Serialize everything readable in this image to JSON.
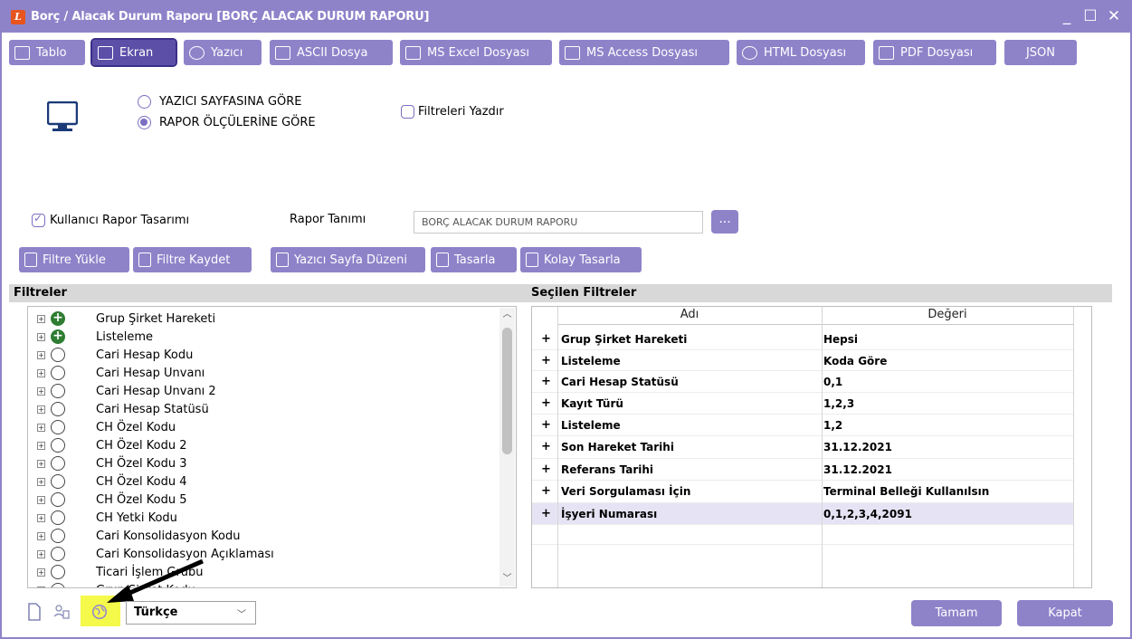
{
  "window": {
    "title": "Borç / Alacak Durum Raporu [BORÇ ALACAK DURUM RAPORU]",
    "controls": [
      "_",
      "☐",
      "✕"
    ]
  },
  "tabs": [
    {
      "label": "Tablo",
      "icon": "table-icon"
    },
    {
      "label": "Ekran",
      "icon": "monitor-icon",
      "active": true
    },
    {
      "label": "Yazıcı",
      "icon": "printer-icon"
    },
    {
      "label": "ASCII Dosya",
      "icon": "ascii-file-icon"
    },
    {
      "label": "MS Excel Dosyası",
      "icon": "excel-file-icon"
    },
    {
      "label": "MS Access Dosyası",
      "icon": "access-file-icon"
    },
    {
      "label": "HTML Dosyası",
      "icon": "globe-icon"
    },
    {
      "label": "PDF Dosyası",
      "icon": "pdf-file-icon"
    },
    {
      "label": "JSON",
      "icon": ""
    }
  ],
  "output": {
    "radio_page": "YAZICI SAYFASINA GÖRE",
    "radio_report": "RAPOR ÖLÇÜLERİNE GÖRE",
    "radio_selected": "RAPOR ÖLÇÜLERİNE GÖRE",
    "print_filters": "Filtreleri Yazdır"
  },
  "design": {
    "user_design_label": "Kullanıcı Rapor Tasarımı",
    "user_design_checked": true,
    "report_def_label": "Rapor Tanımı",
    "report_def_value": "BORÇ ALACAK DURUM RAPORU",
    "browse": "..."
  },
  "toolbar": {
    "load_filter": "Filtre Yükle",
    "save_filter": "Filtre Kaydet",
    "page_layout": "Yazıcı Sayfa Düzeni",
    "design": "Tasarla",
    "easy_design": "Kolay Tasarla"
  },
  "filters_header": "Filtreler",
  "selected_header": "Seçilen Filtreler",
  "filter_tree": [
    {
      "label": "Grup Şirket Hareketi",
      "node": "plus"
    },
    {
      "label": "Listeleme",
      "node": "plus"
    },
    {
      "label": "Cari Hesap Kodu",
      "node": "empty"
    },
    {
      "label": "Cari Hesap Unvanı",
      "node": "empty"
    },
    {
      "label": "Cari Hesap Unvanı 2",
      "node": "empty"
    },
    {
      "label": "Cari Hesap Statüsü",
      "node": "empty"
    },
    {
      "label": "CH Özel Kodu",
      "node": "empty"
    },
    {
      "label": "CH Özel Kodu 2",
      "node": "empty"
    },
    {
      "label": "CH Özel Kodu 3",
      "node": "empty"
    },
    {
      "label": "CH Özel Kodu 4",
      "node": "empty"
    },
    {
      "label": "CH Özel Kodu 5",
      "node": "empty"
    },
    {
      "label": "CH Yetki Kodu",
      "node": "empty"
    },
    {
      "label": "Cari Konsolidasyon Kodu",
      "node": "empty"
    },
    {
      "label": "Cari Konsolidasyon Açıklaması",
      "node": "empty"
    },
    {
      "label": "Ticari İşlem Grubu",
      "node": "empty"
    },
    {
      "label": "Grup Şirket Kodu",
      "node": "empty"
    }
  ],
  "grid": {
    "col_name": "Adı",
    "col_value": "Değeri",
    "rows": [
      {
        "name": "Grup Şirket Hareketi",
        "value": "Hepsi"
      },
      {
        "name": "Listeleme",
        "value": "Koda Göre"
      },
      {
        "name": "Cari Hesap Statüsü",
        "value": "0,1"
      },
      {
        "name": "Kayıt Türü",
        "value": "1,2,3"
      },
      {
        "name": "Listeleme",
        "value": "1,2"
      },
      {
        "name": "Son Hareket Tarihi",
        "value": "31.12.2021"
      },
      {
        "name": "Referans Tarihi",
        "value": "31.12.2021"
      },
      {
        "name": "Veri Sorgulaması İçin",
        "value": "Terminal Belleği Kullanılsın"
      },
      {
        "name": "İşyeri Numarası",
        "value": "0,1,2,3,4,2091"
      }
    ]
  },
  "footer": {
    "language": "Türkçe",
    "ok": "Tamam",
    "close": "Kapat"
  },
  "colors": {
    "accent": "#8e83c9",
    "accent_active": "#5c4fa8",
    "highlight": "#f4f94a"
  }
}
